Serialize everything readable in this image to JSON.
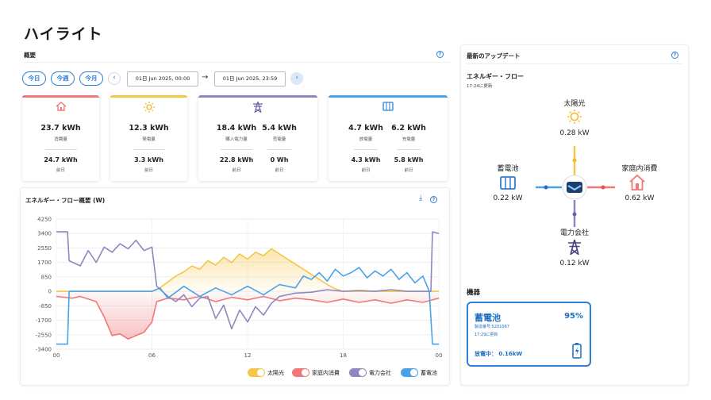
{
  "page": {
    "title": "ハイライト"
  },
  "overview": {
    "title": "概要",
    "chips": [
      "今日",
      "今週",
      "今月"
    ],
    "date_from": "01日 Jun 2025, 00:00",
    "date_to": "01日 Jun 2025, 23:59",
    "arrow": "→",
    "cards": [
      {
        "icon": "home-icon",
        "color": "#f07878",
        "cols": [
          {
            "value": "23.7 kWh",
            "label": "消費量",
            "prev_value": "24.7 kWh",
            "prev_label": "前日"
          }
        ]
      },
      {
        "icon": "sun-icon",
        "color": "#f5c64a",
        "cols": [
          {
            "value": "12.3 kWh",
            "label": "発電量",
            "prev_value": "3.3 kWh",
            "prev_label": "前日"
          }
        ]
      },
      {
        "icon": "pylon-icon",
        "color": "#8f87bf",
        "cols": [
          {
            "value": "18.4 kWh",
            "label": "購入電力量",
            "prev_value": "22.8 kWh",
            "prev_label": "前日"
          },
          {
            "value": "5.4 kWh",
            "label": "売電量",
            "prev_value": "0 Wh",
            "prev_label": "前日"
          }
        ]
      },
      {
        "icon": "battery-icon",
        "color": "#4aa3e8",
        "cols": [
          {
            "value": "4.7 kWh",
            "label": "放電量",
            "prev_value": "4.3 kWh",
            "prev_label": "前日"
          },
          {
            "value": "6.2 kWh",
            "label": "充電量",
            "prev_value": "5.8 kWh",
            "prev_label": "前日"
          }
        ]
      }
    ]
  },
  "chart_section": {
    "title": "エネルギー・フロー概要 (W)"
  },
  "chart_data": {
    "type": "area",
    "title": "エネルギー・フロー概要 (W)",
    "x_ticks": [
      "00",
      "06",
      "12",
      "18",
      "00"
    ],
    "y_ticks": [
      4250,
      3400,
      2550,
      1700,
      850,
      0,
      -850,
      -1700,
      -2550,
      -3400
    ],
    "ylim": [
      -3400,
      4250
    ],
    "x_range_hours": [
      0,
      24
    ],
    "legend_position": "bottom-right",
    "series": [
      {
        "name": "太陽光",
        "color": "#f5c64a",
        "points": [
          [
            0,
            0
          ],
          [
            6,
            0
          ],
          [
            6.5,
            200
          ],
          [
            7,
            550
          ],
          [
            7.5,
            900
          ],
          [
            8,
            1150
          ],
          [
            8.5,
            1500
          ],
          [
            9,
            1300
          ],
          [
            9.5,
            1800
          ],
          [
            10,
            1550
          ],
          [
            10.5,
            2000
          ],
          [
            11,
            1700
          ],
          [
            11.5,
            2200
          ],
          [
            12,
            1900
          ],
          [
            12.5,
            2300
          ],
          [
            13,
            2100
          ],
          [
            13.5,
            2500
          ],
          [
            14,
            2200
          ],
          [
            14.5,
            1900
          ],
          [
            15,
            1600
          ],
          [
            15.5,
            1300
          ],
          [
            16,
            1000
          ],
          [
            16.5,
            700
          ],
          [
            17,
            400
          ],
          [
            17.5,
            150
          ],
          [
            18,
            0
          ],
          [
            24,
            0
          ]
        ]
      },
      {
        "name": "家庭内消費",
        "color": "#f07878",
        "points": [
          [
            0,
            -300
          ],
          [
            1,
            -400
          ],
          [
            1.5,
            -300
          ],
          [
            2,
            -450
          ],
          [
            2.5,
            -600
          ],
          [
            3,
            -1500
          ],
          [
            3.5,
            -2600
          ],
          [
            4,
            -2500
          ],
          [
            4.5,
            -2800
          ],
          [
            5,
            -2600
          ],
          [
            5.5,
            -2400
          ],
          [
            6,
            -1800
          ],
          [
            6.3,
            -600
          ],
          [
            7,
            -400
          ],
          [
            8,
            -500
          ],
          [
            9,
            -300
          ],
          [
            10,
            -600
          ],
          [
            11,
            -350
          ],
          [
            12,
            -500
          ],
          [
            13,
            -300
          ],
          [
            14,
            -550
          ],
          [
            15,
            -400
          ],
          [
            16,
            -500
          ],
          [
            17,
            -650
          ],
          [
            18,
            -450
          ],
          [
            19,
            -650
          ],
          [
            20,
            -500
          ],
          [
            21,
            -700
          ],
          [
            22,
            -500
          ],
          [
            23,
            -650
          ],
          [
            24,
            -400
          ]
        ]
      },
      {
        "name": "電力会社",
        "color": "#8f87bf",
        "points": [
          [
            0,
            3500
          ],
          [
            0.7,
            3500
          ],
          [
            0.8,
            1800
          ],
          [
            1.5,
            1500
          ],
          [
            2,
            2400
          ],
          [
            2.5,
            1700
          ],
          [
            3,
            2600
          ],
          [
            3.5,
            2300
          ],
          [
            4,
            2800
          ],
          [
            4.5,
            2500
          ],
          [
            5,
            3000
          ],
          [
            5.5,
            2400
          ],
          [
            6,
            2600
          ],
          [
            6.3,
            300
          ],
          [
            7,
            -300
          ],
          [
            7.5,
            -600
          ],
          [
            8,
            -200
          ],
          [
            8.5,
            -900
          ],
          [
            9,
            -400
          ],
          [
            9.5,
            -300
          ],
          [
            10,
            -1600
          ],
          [
            10.5,
            -800
          ],
          [
            11,
            -2200
          ],
          [
            11.5,
            -1100
          ],
          [
            12,
            -1800
          ],
          [
            12.5,
            -900
          ],
          [
            13,
            -1400
          ],
          [
            13.5,
            -700
          ],
          [
            14,
            -300
          ],
          [
            15,
            -100
          ],
          [
            16,
            -50
          ],
          [
            17,
            100
          ],
          [
            18,
            0
          ],
          [
            19,
            50
          ],
          [
            20,
            0
          ],
          [
            21,
            100
          ],
          [
            22,
            0
          ],
          [
            23.5,
            0
          ],
          [
            23.6,
            3500
          ],
          [
            24,
            3400
          ]
        ]
      },
      {
        "name": "蓄電池",
        "color": "#4aa3e8",
        "points": [
          [
            0,
            -3100
          ],
          [
            0.7,
            -3100
          ],
          [
            0.8,
            0
          ],
          [
            6,
            0
          ],
          [
            6.5,
            200
          ],
          [
            7,
            -400
          ],
          [
            8,
            300
          ],
          [
            9,
            -300
          ],
          [
            10,
            200
          ],
          [
            11,
            -200
          ],
          [
            12,
            300
          ],
          [
            13,
            -200
          ],
          [
            14,
            400
          ],
          [
            15,
            200
          ],
          [
            15.5,
            900
          ],
          [
            16,
            700
          ],
          [
            16.5,
            1100
          ],
          [
            17,
            600
          ],
          [
            17.5,
            1300
          ],
          [
            18,
            900
          ],
          [
            18.5,
            1100
          ],
          [
            19,
            1400
          ],
          [
            19.5,
            800
          ],
          [
            20,
            1200
          ],
          [
            20.5,
            900
          ],
          [
            21,
            1300
          ],
          [
            21.5,
            700
          ],
          [
            22,
            1100
          ],
          [
            22.5,
            500
          ],
          [
            23,
            900
          ],
          [
            23.4,
            0
          ],
          [
            23.6,
            -3100
          ],
          [
            24,
            -3100
          ]
        ]
      }
    ]
  },
  "latest": {
    "title": "最新のアップデート",
    "flow_title": "エネルギー・フロー",
    "flow_updated": "17:24に更新",
    "solar": {
      "label": "太陽光",
      "value": "0.28 kW"
    },
    "battery": {
      "label": "蓄電池",
      "value": "0.22 kW"
    },
    "home": {
      "label": "家庭内消費",
      "value": "0.62 kW"
    },
    "grid": {
      "label": "電力会社",
      "value": "0.12 kW"
    },
    "devices_title": "機器",
    "device": {
      "name": "蓄電池",
      "percent": "95%",
      "serial": "製造番号:5201067",
      "updated": "17:29に更新",
      "status": "放電中： 0.16kW",
      "level": 0.95
    }
  }
}
